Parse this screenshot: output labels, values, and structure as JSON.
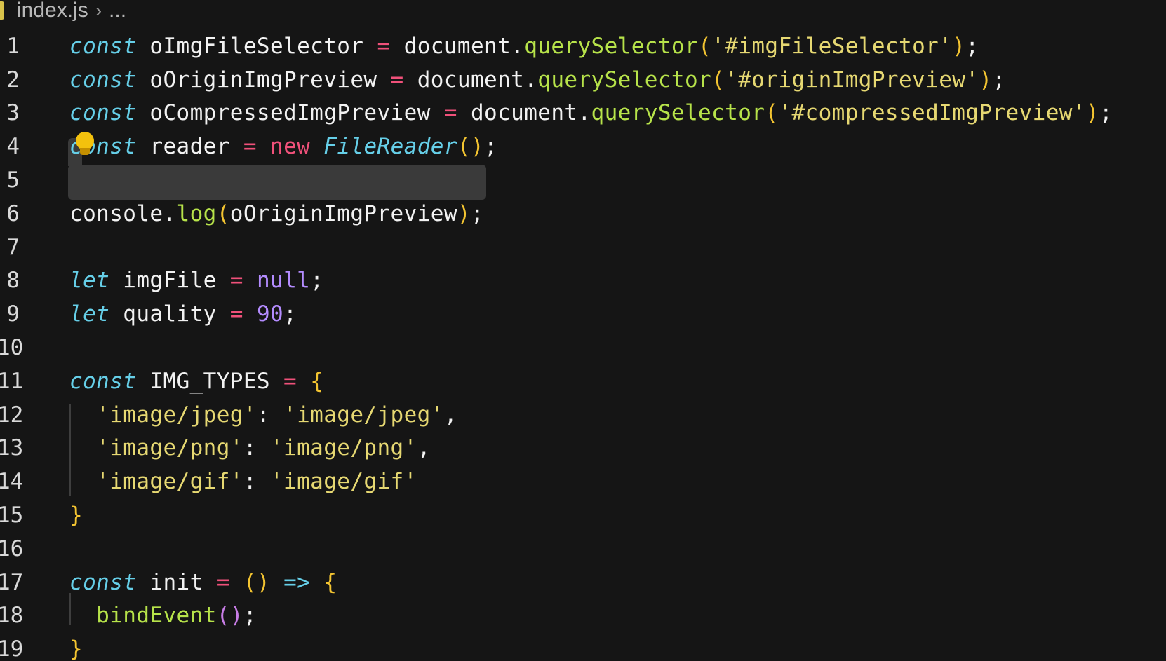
{
  "breadcrumb": {
    "file": "index.js",
    "rest": "..."
  },
  "lines": [
    {
      "num": "1",
      "tokens": [
        {
          "t": "const",
          "c": "kw"
        },
        {
          "t": " ",
          "c": "id"
        },
        {
          "t": "oImgFileSelector",
          "c": "id"
        },
        {
          "t": " ",
          "c": "id"
        },
        {
          "t": "=",
          "c": "op"
        },
        {
          "t": " document.",
          "c": "id"
        },
        {
          "t": "querySelector",
          "c": "fn"
        },
        {
          "t": "(",
          "c": "paren"
        },
        {
          "t": "'#imgFileSelector'",
          "c": "str"
        },
        {
          "t": ")",
          "c": "paren"
        },
        {
          "t": ";",
          "c": "punct"
        }
      ]
    },
    {
      "num": "2",
      "tokens": [
        {
          "t": "const",
          "c": "kw"
        },
        {
          "t": " oOriginImgPreview ",
          "c": "id"
        },
        {
          "t": "=",
          "c": "op"
        },
        {
          "t": " document.",
          "c": "id"
        },
        {
          "t": "querySelector",
          "c": "fn"
        },
        {
          "t": "(",
          "c": "paren"
        },
        {
          "t": "'#originImgPreview'",
          "c": "str"
        },
        {
          "t": ")",
          "c": "paren"
        },
        {
          "t": ";",
          "c": "punct"
        }
      ]
    },
    {
      "num": "3",
      "tokens": [
        {
          "t": "const",
          "c": "kw"
        },
        {
          "t": " oCompressedImgPreview ",
          "c": "id"
        },
        {
          "t": "=",
          "c": "op"
        },
        {
          "t": " document.",
          "c": "id"
        },
        {
          "t": "querySelector",
          "c": "fn"
        },
        {
          "t": "(",
          "c": "paren"
        },
        {
          "t": "'#compressedImgPreview'",
          "c": "str"
        },
        {
          "t": ")",
          "c": "paren"
        },
        {
          "t": ";",
          "c": "punct"
        }
      ]
    },
    {
      "num": "4",
      "tokens": [
        {
          "t": "const",
          "c": "kw"
        },
        {
          "t": " reader ",
          "c": "id"
        },
        {
          "t": "=",
          "c": "op"
        },
        {
          "t": " ",
          "c": "id"
        },
        {
          "t": "new",
          "c": "new"
        },
        {
          "t": " ",
          "c": "id"
        },
        {
          "t": "FileReader",
          "c": "class"
        },
        {
          "t": "()",
          "c": "paren"
        },
        {
          "t": ";",
          "c": "punct"
        }
      ]
    },
    {
      "num": "5",
      "tokens": []
    },
    {
      "num": "6",
      "tokens": [
        {
          "t": "console.",
          "c": "id"
        },
        {
          "t": "log",
          "c": "fn"
        },
        {
          "t": "(",
          "c": "paren"
        },
        {
          "t": "oOriginImgPreview",
          "c": "id"
        },
        {
          "t": ")",
          "c": "paren"
        },
        {
          "t": ";",
          "c": "punct"
        }
      ]
    },
    {
      "num": "7",
      "tokens": []
    },
    {
      "num": "8",
      "tokens": [
        {
          "t": "let",
          "c": "kw"
        },
        {
          "t": " imgFile ",
          "c": "id"
        },
        {
          "t": "=",
          "c": "op"
        },
        {
          "t": " ",
          "c": "id"
        },
        {
          "t": "null",
          "c": "null"
        },
        {
          "t": ";",
          "c": "punct"
        }
      ]
    },
    {
      "num": "9",
      "tokens": [
        {
          "t": "let",
          "c": "kw"
        },
        {
          "t": " quality ",
          "c": "id"
        },
        {
          "t": "=",
          "c": "op"
        },
        {
          "t": " ",
          "c": "id"
        },
        {
          "t": "90",
          "c": "num"
        },
        {
          "t": ";",
          "c": "punct"
        }
      ]
    },
    {
      "num": "10",
      "tokens": []
    },
    {
      "num": "11",
      "tokens": [
        {
          "t": "const",
          "c": "kw"
        },
        {
          "t": " IMG_TYPES ",
          "c": "id"
        },
        {
          "t": "=",
          "c": "op"
        },
        {
          "t": " ",
          "c": "id"
        },
        {
          "t": "{",
          "c": "paren"
        }
      ]
    },
    {
      "num": "12",
      "tokens": [
        {
          "t": "  ",
          "c": "id"
        },
        {
          "t": "'image/jpeg'",
          "c": "str"
        },
        {
          "t": ": ",
          "c": "punct"
        },
        {
          "t": "'image/jpeg'",
          "c": "str"
        },
        {
          "t": ",",
          "c": "punct"
        }
      ]
    },
    {
      "num": "13",
      "tokens": [
        {
          "t": "  ",
          "c": "id"
        },
        {
          "t": "'image/png'",
          "c": "str"
        },
        {
          "t": ": ",
          "c": "punct"
        },
        {
          "t": "'image/png'",
          "c": "str"
        },
        {
          "t": ",",
          "c": "punct"
        }
      ]
    },
    {
      "num": "14",
      "tokens": [
        {
          "t": "  ",
          "c": "id"
        },
        {
          "t": "'image/gif'",
          "c": "str"
        },
        {
          "t": ": ",
          "c": "punct"
        },
        {
          "t": "'image/gif'",
          "c": "str"
        }
      ]
    },
    {
      "num": "15",
      "tokens": [
        {
          "t": "}",
          "c": "paren"
        }
      ]
    },
    {
      "num": "16",
      "tokens": []
    },
    {
      "num": "17",
      "tokens": [
        {
          "t": "const",
          "c": "kw"
        },
        {
          "t": " init ",
          "c": "id"
        },
        {
          "t": "=",
          "c": "op"
        },
        {
          "t": " ",
          "c": "id"
        },
        {
          "t": "()",
          "c": "paren"
        },
        {
          "t": " ",
          "c": "id"
        },
        {
          "t": "=>",
          "c": "arrow"
        },
        {
          "t": " ",
          "c": "id"
        },
        {
          "t": "{",
          "c": "paren"
        }
      ]
    },
    {
      "num": "18",
      "tokens": [
        {
          "t": "  ",
          "c": "id"
        },
        {
          "t": "bindEvent",
          "c": "fn"
        },
        {
          "t": "()",
          "c": "paren2"
        },
        {
          "t": ";",
          "c": "punct"
        }
      ]
    },
    {
      "num": "19",
      "tokens": [
        {
          "t": "}",
          "c": "paren"
        }
      ]
    }
  ],
  "theme": {
    "background": "#151515",
    "keyword": "#66cfe8",
    "operator": "#f0517a",
    "function": "#b7e34a",
    "string": "#e6d872",
    "number": "#b48cff",
    "bracket": "#f3c431"
  }
}
